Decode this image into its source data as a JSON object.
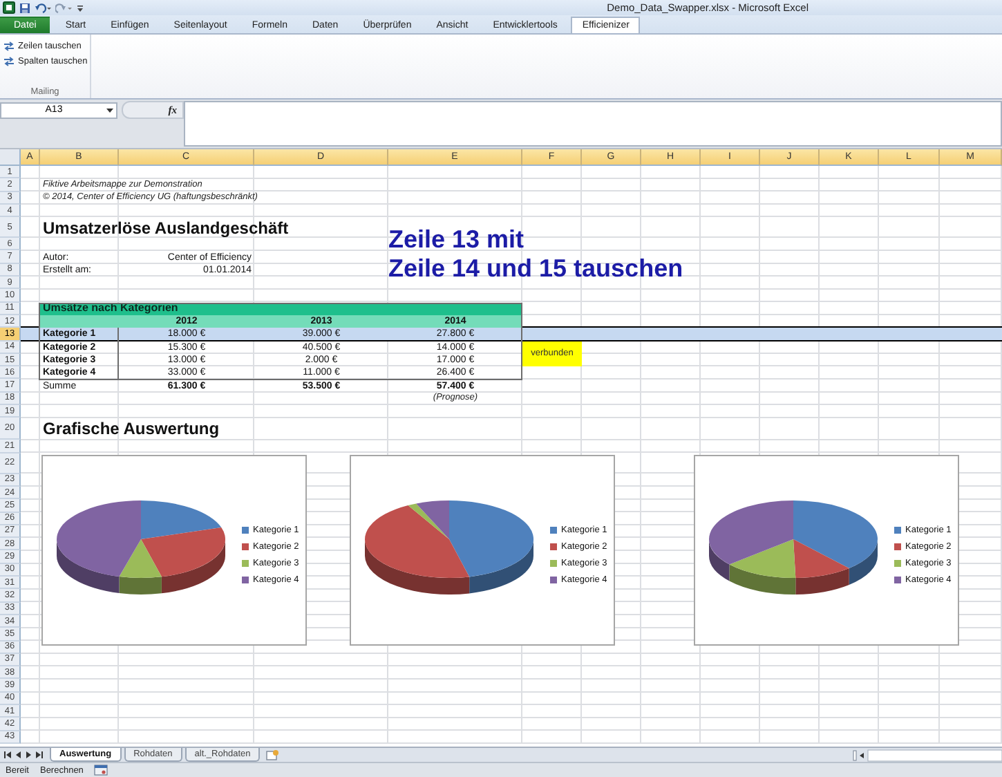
{
  "window": {
    "title": "Demo_Data_Swapper.xlsx - Microsoft Excel"
  },
  "ribbon_tabs": [
    {
      "label": "Datei",
      "kind": "file",
      "selected": false
    },
    {
      "label": "Start",
      "kind": "tab",
      "selected": false
    },
    {
      "label": "Einfügen",
      "kind": "tab",
      "selected": false
    },
    {
      "label": "Seitenlayout",
      "kind": "tab",
      "selected": false
    },
    {
      "label": "Formeln",
      "kind": "tab",
      "selected": false
    },
    {
      "label": "Daten",
      "kind": "tab",
      "selected": false
    },
    {
      "label": "Überprüfen",
      "kind": "tab",
      "selected": false
    },
    {
      "label": "Ansicht",
      "kind": "tab",
      "selected": false
    },
    {
      "label": "Entwicklertools",
      "kind": "tab",
      "selected": false
    },
    {
      "label": "Efficienizer",
      "kind": "tab",
      "selected": true
    }
  ],
  "ribbon": {
    "buttons": [
      "Zeilen tauschen",
      "Spalten tauschen"
    ],
    "group_label": "Mailing"
  },
  "formula_bar": {
    "name_box": "A13",
    "function_button": "fx"
  },
  "columns": [
    "A",
    "B",
    "C",
    "D",
    "E",
    "F",
    "G",
    "H",
    "I",
    "J",
    "K",
    "L",
    "M"
  ],
  "row_headers": [
    {
      "label": "1",
      "selected": false
    },
    {
      "label": "2",
      "selected": false
    },
    {
      "label": "3",
      "selected": false
    },
    {
      "label": "4",
      "selected": false
    },
    {
      "label": "5",
      "selected": false
    },
    {
      "label": "6",
      "selected": false
    },
    {
      "label": "7",
      "selected": false
    },
    {
      "label": "8",
      "selected": false
    },
    {
      "label": "9",
      "selected": false
    },
    {
      "label": "10",
      "selected": false
    },
    {
      "label": "11",
      "selected": false
    },
    {
      "label": "12",
      "selected": false
    },
    {
      "label": "13",
      "selected": true
    },
    {
      "label": "14",
      "selected": false
    },
    {
      "label": "15",
      "selected": false
    },
    {
      "label": "16",
      "selected": false
    },
    {
      "label": "17",
      "selected": false
    },
    {
      "label": "18",
      "selected": false
    },
    {
      "label": "19",
      "selected": false
    },
    {
      "label": "20",
      "selected": false
    },
    {
      "label": "21",
      "selected": false
    },
    {
      "label": "22",
      "selected": false
    },
    {
      "label": "23",
      "selected": false
    },
    {
      "label": "24",
      "selected": false
    },
    {
      "label": "25",
      "selected": false
    },
    {
      "label": "26",
      "selected": false
    },
    {
      "label": "27",
      "selected": false
    },
    {
      "label": "28",
      "selected": false
    },
    {
      "label": "29",
      "selected": false
    },
    {
      "label": "30",
      "selected": false
    },
    {
      "label": "31",
      "selected": false
    },
    {
      "label": "32",
      "selected": false
    },
    {
      "label": "33",
      "selected": false
    },
    {
      "label": "34",
      "selected": false
    },
    {
      "label": "35",
      "selected": false
    },
    {
      "label": "36",
      "selected": false
    },
    {
      "label": "37",
      "selected": false
    },
    {
      "label": "38",
      "selected": false
    },
    {
      "label": "39",
      "selected": false
    },
    {
      "label": "40",
      "selected": false
    },
    {
      "label": "41",
      "selected": false
    },
    {
      "label": "42",
      "selected": false
    },
    {
      "label": "43",
      "selected": false
    }
  ],
  "sheet": {
    "notes": [
      "Fiktive Arbeitsmappe zur Demonstration",
      "© 2014, Center of Efficiency UG (haftungsbeschränkt)"
    ],
    "title": "Umsatzerlöse Auslandgeschäft",
    "fields": [
      {
        "label": "Autor:",
        "value": "Center of Efficiency"
      },
      {
        "label": "Erstellt am:",
        "value": "01.01.2014"
      }
    ],
    "annotation": [
      "Zeile 13 mit",
      "Zeile 14 und 15 tauschen"
    ],
    "table": {
      "title": "Umsätze nach Kategorien",
      "years": [
        "2012",
        "2013",
        "2014"
      ],
      "rows": [
        {
          "category": "Kategorie 1",
          "values": [
            "18.000 €",
            "39.000 €",
            "27.800 €"
          ]
        },
        {
          "category": "Kategorie 2",
          "values": [
            "15.300 €",
            "40.500 €",
            "14.000 €"
          ]
        },
        {
          "category": "Kategorie 3",
          "values": [
            "13.000 €",
            "2.000 €",
            "17.000 €"
          ]
        },
        {
          "category": "Kategorie 4",
          "values": [
            "33.000 €",
            "11.000 €",
            "26.400 €"
          ]
        }
      ],
      "total": {
        "label": "Summe",
        "values": [
          "61.300 €",
          "53.500 €",
          "57.400 €"
        ]
      },
      "footnote": "(Prognose)"
    },
    "merged_note": "verbunden",
    "section_title": "Grafische Auswertung",
    "charts": [
      {
        "kind": "pie",
        "legend": [
          {
            "label": "Kategorie 1",
            "color": "#4f81bd"
          },
          {
            "label": "Kategorie 2",
            "color": "#c0504d"
          },
          {
            "label": "Kategorie 3",
            "color": "#9bbb59"
          },
          {
            "label": "Kategorie 4",
            "color": "#8064a2"
          }
        ]
      },
      {
        "kind": "pie",
        "legend": [
          {
            "label": "Kategorie 1",
            "color": "#4f81bd"
          },
          {
            "label": "Kategorie 2",
            "color": "#c0504d"
          },
          {
            "label": "Kategorie 3",
            "color": "#9bbb59"
          },
          {
            "label": "Kategorie 4",
            "color": "#8064a2"
          }
        ]
      },
      {
        "kind": "pie",
        "legend": [
          {
            "label": "Kategorie 1",
            "color": "#4f81bd"
          },
          {
            "label": "Kategorie 2",
            "color": "#c0504d"
          },
          {
            "label": "Kategorie 3",
            "color": "#9bbb59"
          },
          {
            "label": "Kategorie 4",
            "color": "#8064a2"
          }
        ]
      }
    ]
  },
  "sheet_tabs": [
    {
      "label": "Auswertung",
      "selected": true
    },
    {
      "label": "Rohdaten",
      "selected": false
    },
    {
      "label": "alt._Rohdaten",
      "selected": false
    }
  ],
  "status_bar": [
    "Bereit",
    "Berechnen"
  ]
}
